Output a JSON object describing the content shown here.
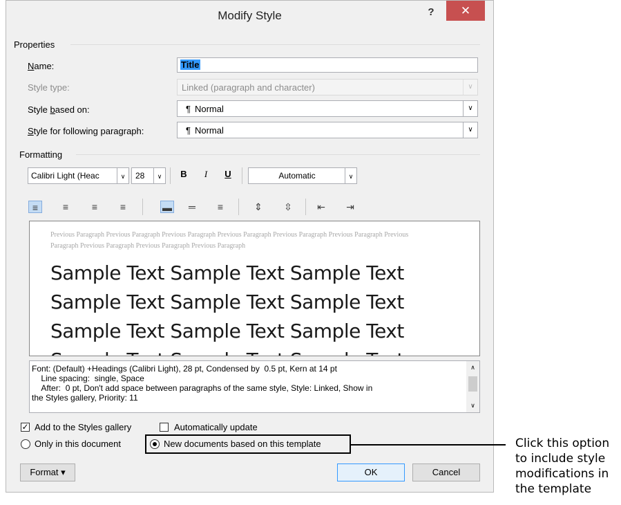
{
  "window": {
    "title": "Modify Style",
    "help": "?",
    "close": "✕"
  },
  "properties": {
    "section_label": "Properties",
    "name_label": "Name:",
    "name_value": "Title",
    "style_type_label": "Style type:",
    "style_type_value": "Linked (paragraph and character)",
    "based_on_label": "Style based on:",
    "based_on_value": "Normal",
    "following_label": "Style for following paragraph:",
    "following_value": "Normal",
    "pilcrow": "¶"
  },
  "formatting": {
    "section_label": "Formatting",
    "font": "Calibri Light (Heac",
    "size": "28",
    "bold": "B",
    "italic": "I",
    "underline": "U",
    "color": "Automatic"
  },
  "preview": {
    "previous_paragraph": "Previous Paragraph Previous Paragraph Previous Paragraph Previous Paragraph Previous Paragraph Previous Paragraph Previous Paragraph Previous Paragraph Previous Paragraph Previous Paragraph",
    "sample_line": "Sample Text Sample Text Sample Text"
  },
  "description": "Font: (Default) +Headings (Calibri Light), 28 pt, Condensed by  0.5 pt, Kern at 14 pt\n    Line spacing:  single, Space\n    After:  0 pt, Don't add space between paragraphs of the same style, Style: Linked, Show in\nthe Styles gallery, Priority: 11",
  "options": {
    "add_to_gallery": "Add to the Styles gallery",
    "auto_update": "Automatically update",
    "only_this_doc": "Only in this document",
    "new_docs": "New documents based on this template"
  },
  "buttons": {
    "format": "Format",
    "ok": "OK",
    "cancel": "Cancel"
  },
  "callout": "Click this option to include style modifications in the template",
  "colors": {
    "accent": "#3399ff",
    "close": "#c75050"
  }
}
